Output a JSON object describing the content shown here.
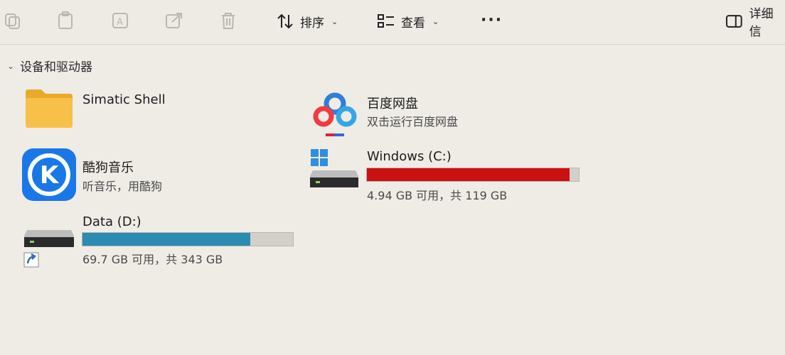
{
  "toolbar": {
    "sort_label": "排序",
    "view_label": "查看",
    "more_label": "···",
    "details_label": "详细信"
  },
  "section": {
    "title": "设备和驱动器"
  },
  "items": {
    "simatic": {
      "title": "Simatic Shell"
    },
    "baidu": {
      "title": "百度网盘",
      "subtitle": "双击运行百度网盘"
    },
    "kugou": {
      "title": "酷狗音乐",
      "subtitle": "听音乐，用酷狗",
      "logo_letter": "K"
    },
    "drive_c": {
      "title": "Windows (C:)",
      "subtitle": "4.94 GB 可用，共 119 GB",
      "used_fraction": 0.958,
      "bar_color": "#cc1010"
    },
    "drive_d": {
      "title": "Data (D:)",
      "subtitle": "69.7 GB 可用，共 343 GB",
      "used_fraction": 0.797,
      "bar_color": "#2b8bb0"
    }
  }
}
